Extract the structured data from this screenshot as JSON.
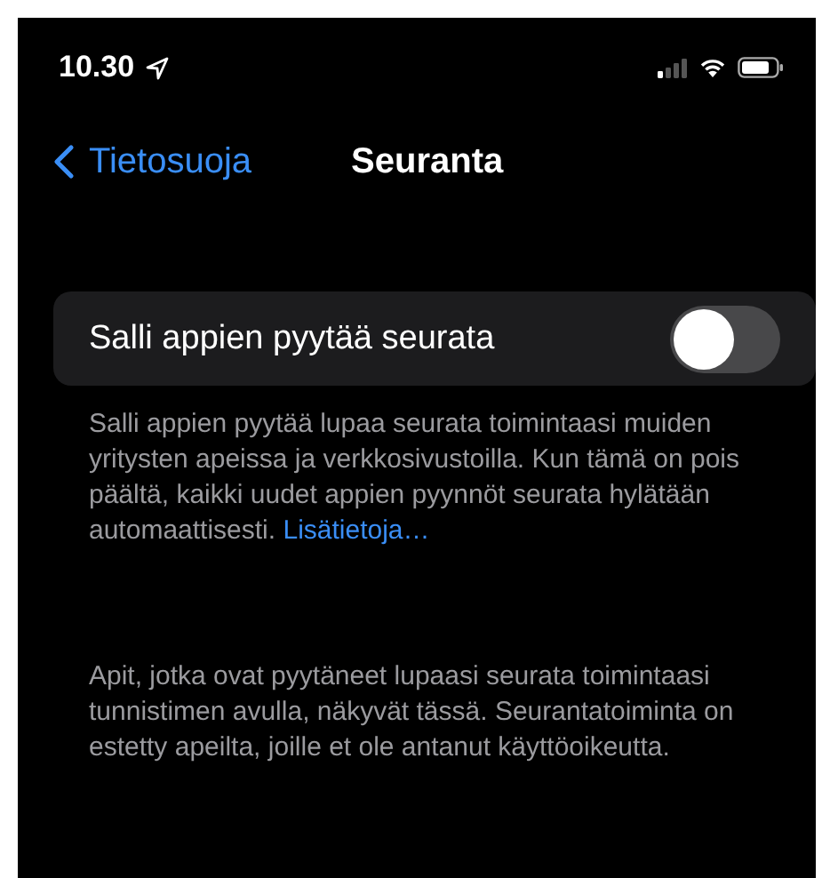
{
  "status_bar": {
    "time": "10.30",
    "location_active": true
  },
  "nav": {
    "back_label": "Tietosuoja",
    "title": "Seuranta"
  },
  "setting": {
    "label": "Salli appien pyytää seurata",
    "on": false
  },
  "footer": {
    "text": "Salli appien pyytää lupaa seurata toimintaasi muiden yritysten apeissa ja verkkosivustoilla. Kun tämä on pois päältä, kaikki uudet appien pyynnöt seurata hylätään automaattisesti.",
    "link": "Lisätietoja…"
  },
  "info": "Apit, jotka ovat pyytäneet lupaasi seurata toimintaasi tunnistimen avulla, näkyvät tässä. Seurantatoiminta on estetty apeilta, joille et ole antanut käyttöoikeutta."
}
